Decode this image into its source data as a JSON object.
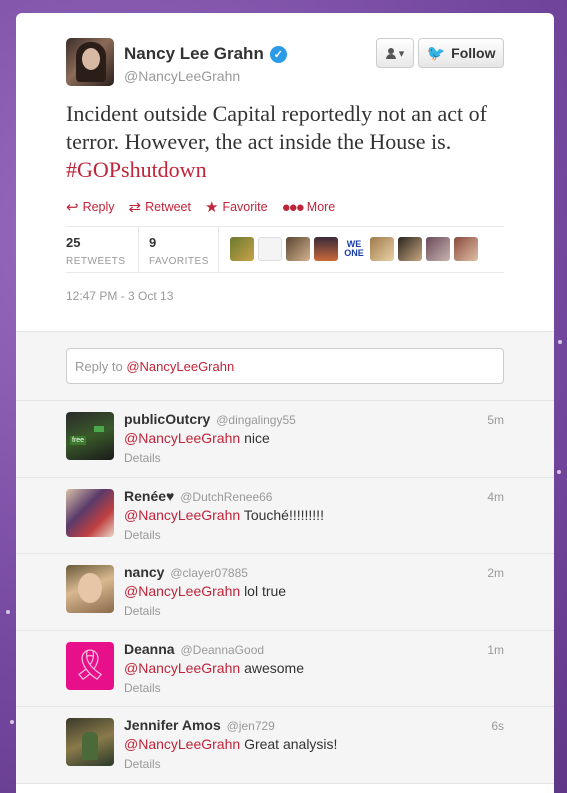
{
  "tweet": {
    "author_name": "Nancy Lee Grahn",
    "author_handle": "@NancyLeeGrahn",
    "text_before": "Incident outside Capital reportedly not an act of terror. However, the act inside the House is.",
    "hashtag": "#GOPshutdown",
    "follow_label": "Follow",
    "actions": [
      {
        "icon": "reply-icon",
        "label": "Reply"
      },
      {
        "icon": "retweet-icon",
        "label": "Retweet"
      },
      {
        "icon": "favorite-star-icon",
        "label": "Favorite"
      },
      {
        "icon": "more-dots-icon",
        "label": "More"
      }
    ],
    "retweets_count": "25",
    "retweets_label": "RETWEETS",
    "favorites_count": "9",
    "favorites_label": "FAVORITES",
    "timestamp": "12:47 PM - 3 Oct 13"
  },
  "reply_box": {
    "prefix": "Reply to",
    "mention": "@NancyLeeGrahn"
  },
  "replies": [
    {
      "name": "publicOutcry",
      "handle": "@dingalingy55",
      "time": "5m",
      "mention": "@NancyLeeGrahn",
      "text": "nice",
      "details": "Details"
    },
    {
      "name": "Renée♥",
      "handle": "@DutchRenee66",
      "time": "4m",
      "mention": "@NancyLeeGrahn",
      "text": "Touché!!!!!!!!!",
      "details": "Details"
    },
    {
      "name": "nancy",
      "handle": "@clayer07885",
      "time": "2m",
      "mention": "@NancyLeeGrahn",
      "text": "lol true",
      "details": "Details"
    },
    {
      "name": "Deanna",
      "handle": "@DeannaGood",
      "time": "1m",
      "mention": "@NancyLeeGrahn",
      "text": "awesome",
      "details": "Details"
    },
    {
      "name": "Jennifer Amos",
      "handle": "@jen729",
      "time": "6s",
      "mention": "@NancyLeeGrahn",
      "text": "Great analysis!",
      "details": "Details"
    }
  ],
  "colors": {
    "accent": "#c0243a",
    "twitter_blue": "#2b9be6",
    "background": "#7d4fa6"
  }
}
